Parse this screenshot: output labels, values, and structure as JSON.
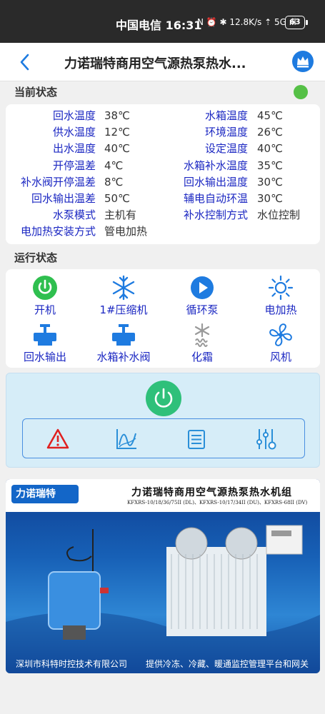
{
  "status_bar": {
    "time": "中国电信 16:31",
    "icons": "N ⏰ ✱ 12.8K/s ⇡ 5G ıll",
    "battery": "63"
  },
  "header": {
    "title": "力诺瑞特商用空气源热泵热水..."
  },
  "current_status": {
    "heading": "当前状态",
    "indicator_color": "#55c046",
    "left": [
      {
        "label": "回水温度",
        "value": "38℃"
      },
      {
        "label": "供水温度",
        "value": "12℃"
      },
      {
        "label": "出水温度",
        "value": "40℃"
      },
      {
        "label": "开停温差",
        "value": "4℃"
      },
      {
        "label": "补水阀开停温差",
        "value": "8℃"
      },
      {
        "label": "回水输出温差",
        "value": "50℃"
      },
      {
        "label": "水泵模式",
        "value": "主机有"
      },
      {
        "label": "电加热安装方式",
        "value": "管电加热"
      }
    ],
    "right": [
      {
        "label": "水箱温度",
        "value": "45℃"
      },
      {
        "label": "环境温度",
        "value": "26℃"
      },
      {
        "label": "设定温度",
        "value": "40℃"
      },
      {
        "label": "水箱补水温度",
        "value": "35℃"
      },
      {
        "label": "回水输出温度",
        "value": "30℃"
      },
      {
        "label": "辅电自动环温",
        "value": "30℃"
      },
      {
        "label": "补水控制方式",
        "value": "水位控制"
      }
    ]
  },
  "run_status": {
    "heading": "运行状态",
    "items": [
      {
        "label": "开机",
        "icon": "power-on-icon",
        "color": "#2fbf4f"
      },
      {
        "label": "1#压缩机",
        "icon": "snowflake-icon",
        "color": "#1e7be0"
      },
      {
        "label": "循环泵",
        "icon": "play-circle-icon",
        "color": "#1e7be0"
      },
      {
        "label": "电加热",
        "icon": "sun-icon",
        "color": "#1e7be0"
      },
      {
        "label": "回水输出",
        "icon": "valve-icon",
        "color": "#1e7be0"
      },
      {
        "label": "水箱补水阀",
        "icon": "valve-icon",
        "color": "#1e7be0"
      },
      {
        "label": "化霜",
        "icon": "defrost-icon",
        "color": "#9a9a9a"
      },
      {
        "label": "风机",
        "icon": "fan-icon",
        "color": "#1e7be0"
      }
    ]
  },
  "control_panel": {
    "power_icon": "power-button-icon",
    "tools": [
      "warning-icon",
      "trend-chart-icon",
      "list-icon",
      "settings-sliders-icon"
    ]
  },
  "banner": {
    "logo": "力诺瑞特",
    "title": "力诺瑞特商用空气源热泵热水机组",
    "subtitle": "KFXRS-10/18/36/75II (DL)、KFXRS-10/17/34II (DU)、KFXRS-68II (DV)",
    "footer_left": "深圳市科特时控技术有限公司",
    "footer_right": "提供冷冻、冷藏、暖通监控管理平台和网关"
  }
}
